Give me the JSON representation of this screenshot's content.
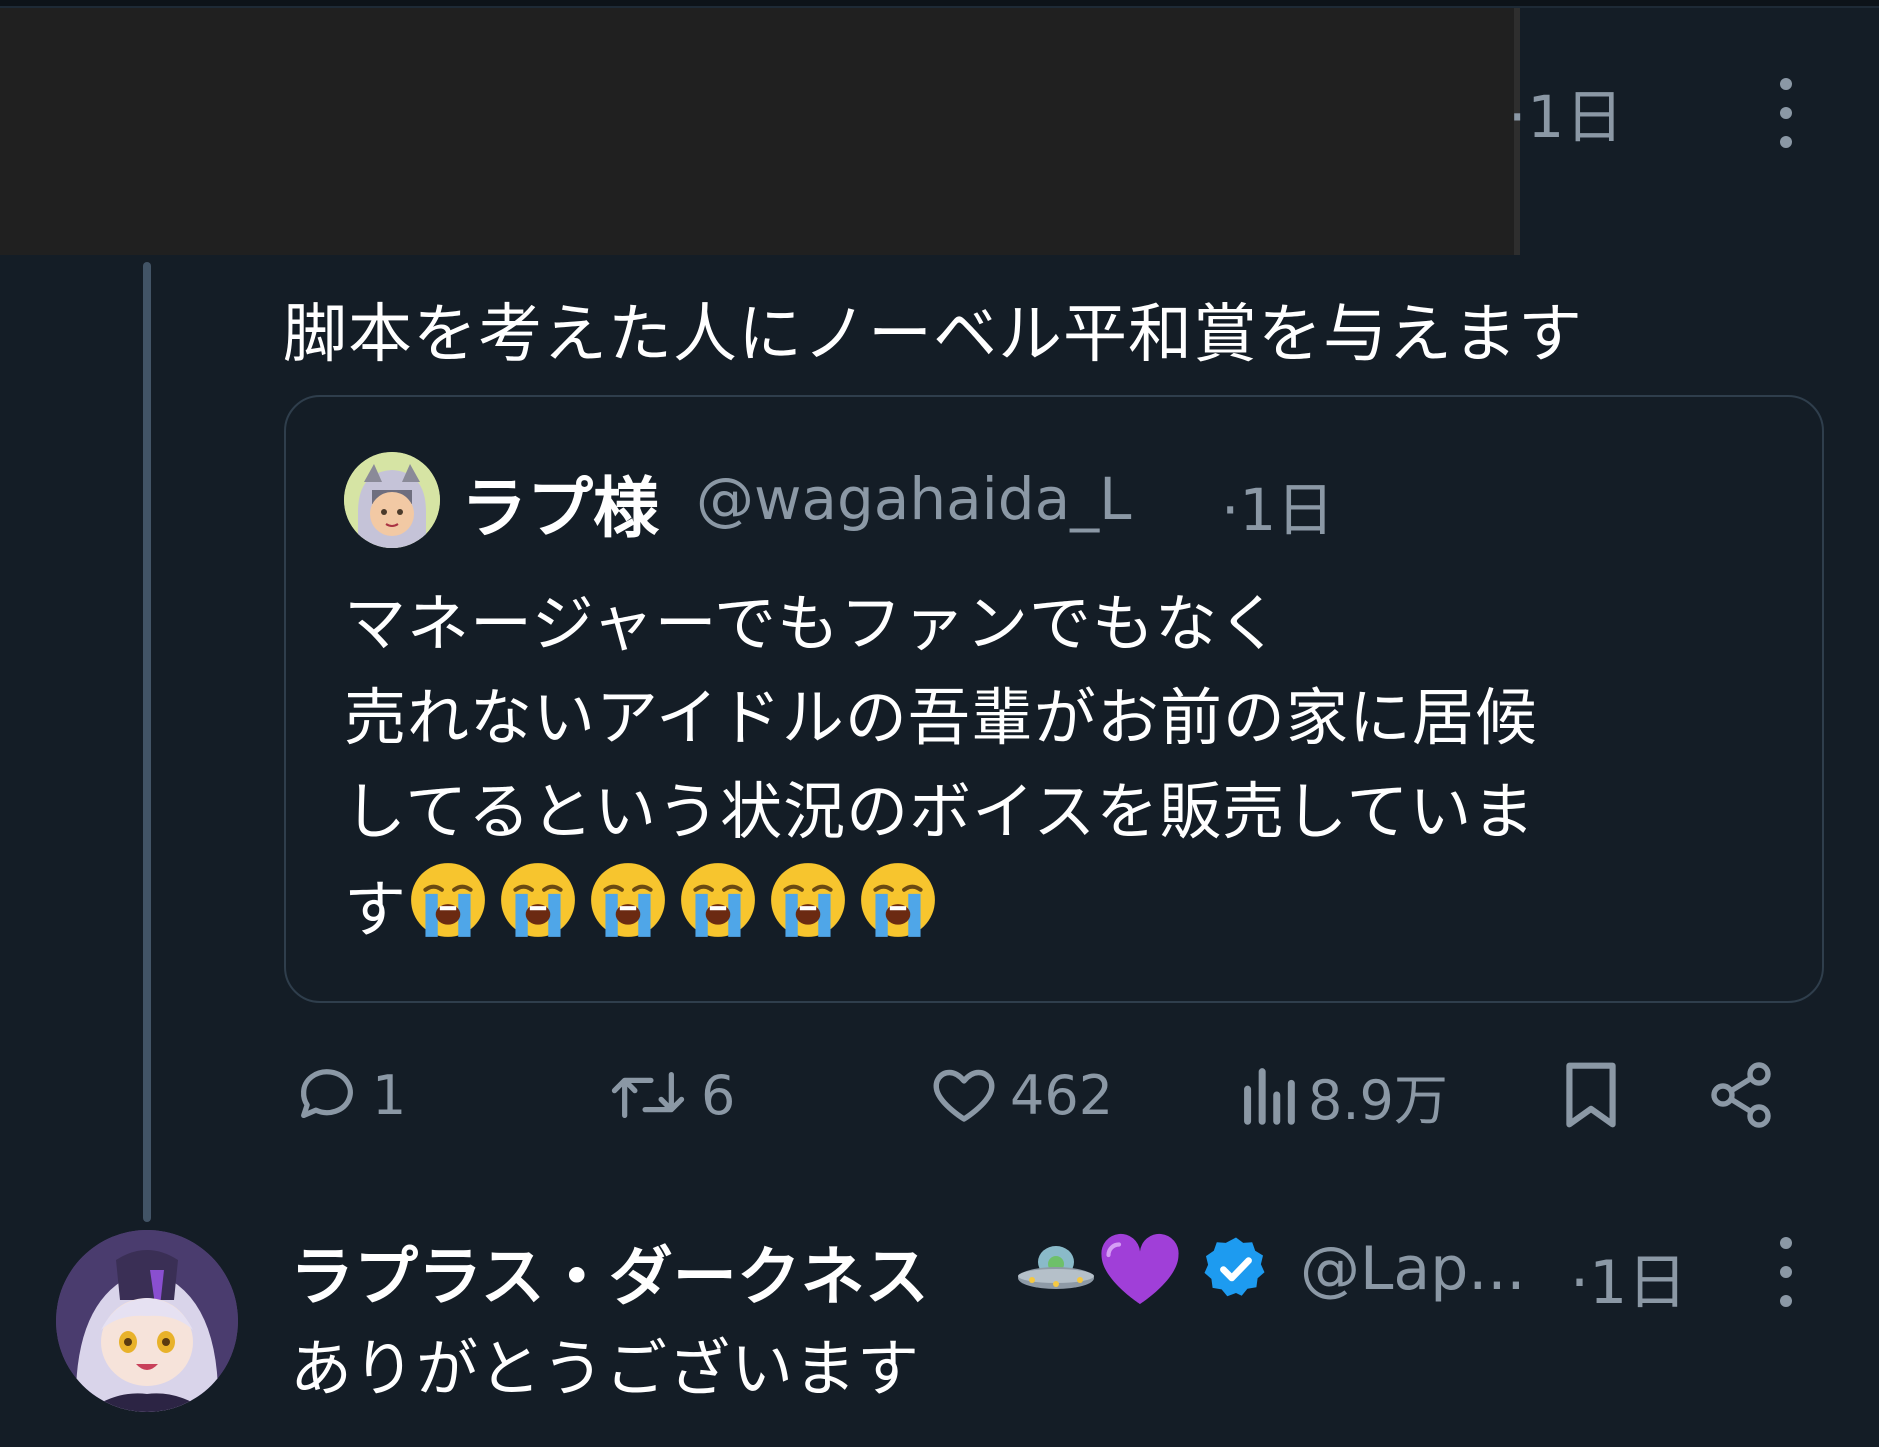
{
  "top_tweet": {
    "time": "·1日",
    "text": "脚本を考えた人にノーベル平和賞を与えます"
  },
  "quote": {
    "name": "ラプ様",
    "handle": "@wagahaida_L",
    "time": "·1日",
    "lines": [
      "マネージャーでもファンでもなく",
      "売れないアイドルの吾輩がお前の家に居候",
      "してるという状況のボイスを販売していま",
      "す"
    ],
    "emoji_count_label": "😭😭😭😭😭😭"
  },
  "actions": {
    "reply_count": "1",
    "retweet_count": "6",
    "like_count": "462",
    "views_count": "8.9万"
  },
  "reply": {
    "name": "ラプラス・ダークネス",
    "handle": "@Lap...",
    "time": "·1日",
    "text": "ありがとうございます"
  },
  "icons": {
    "more": "kebab-icon",
    "reply": "comment-icon",
    "retweet": "retweet-icon",
    "like": "heart-icon",
    "views": "bar-chart-icon",
    "bookmark": "bookmark-icon",
    "share": "share-icon",
    "verified": "verified-badge-icon",
    "ufo": "ufo-emoji",
    "heart": "purple-heart-emoji",
    "crying": "loudly-crying-face-emoji"
  },
  "colors": {
    "background": "#141d26",
    "muted_text": "#8b98a5",
    "verified": "#1d9bf0",
    "purple_heart": "#a03fd8"
  }
}
